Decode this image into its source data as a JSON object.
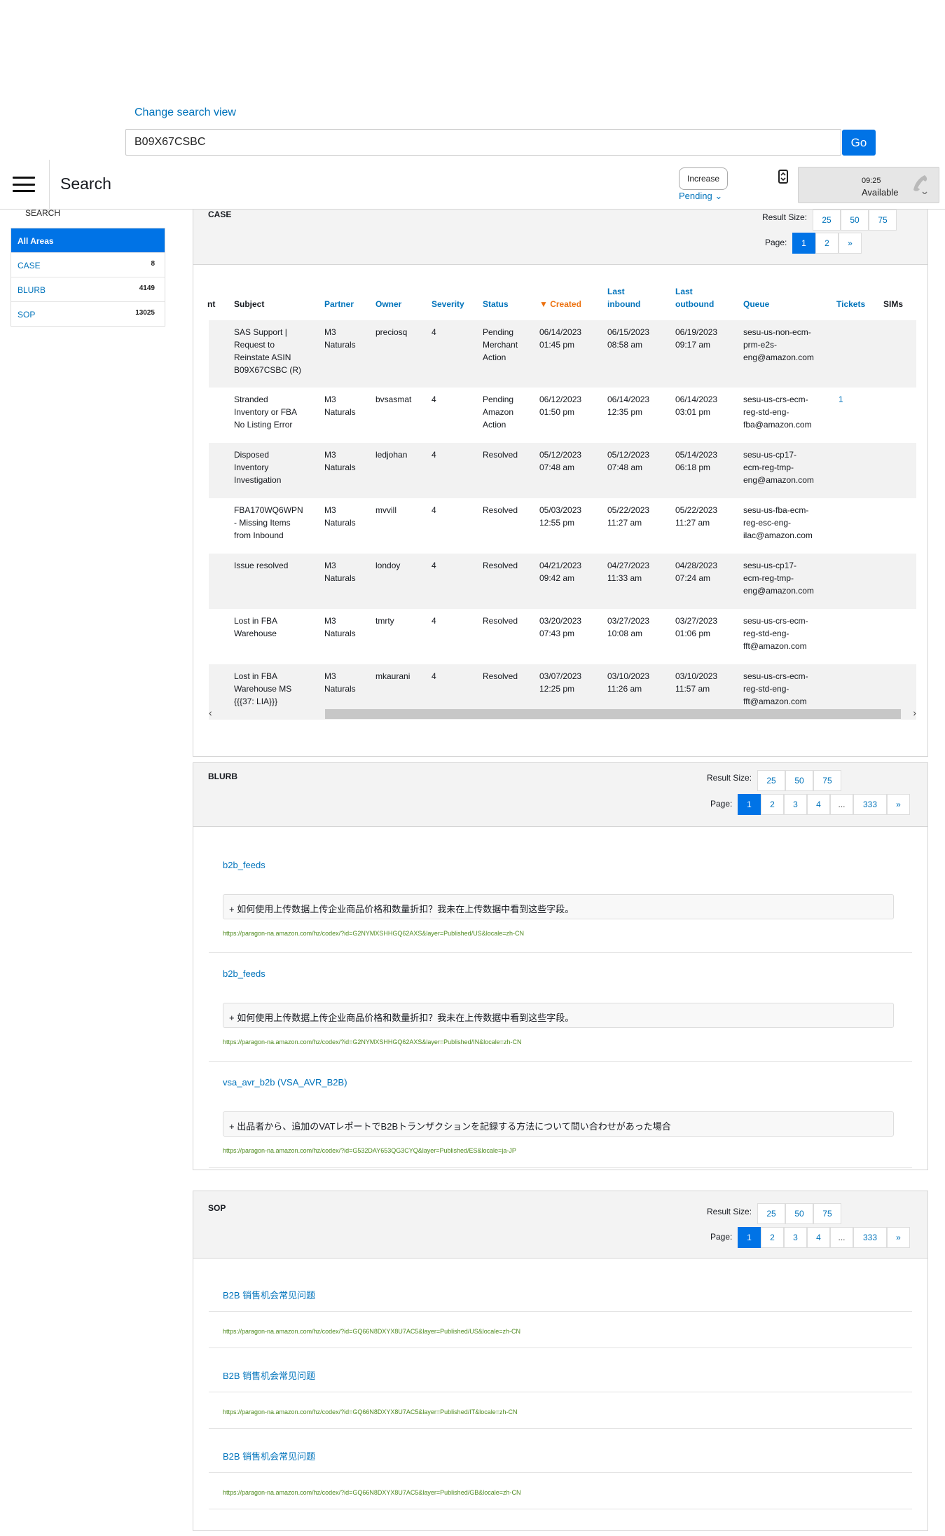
{
  "search": {
    "change_view": "Change search view",
    "query": "B09X67CSBC",
    "go_label": "Go"
  },
  "header": {
    "title": "Search",
    "increase_label": "Increase",
    "pending_label": "Pending ⌄",
    "status_time": "09:25",
    "status_text": "Available"
  },
  "sidebar": {
    "heading": "SEARCH",
    "items": [
      {
        "label": "All Areas",
        "count": ""
      },
      {
        "label": "CASE",
        "count": "8"
      },
      {
        "label": "BLURB",
        "count": "4149"
      },
      {
        "label": "SOP",
        "count": "13025"
      }
    ]
  },
  "pagination_labels": {
    "result_size": "Result Size:",
    "page": "Page:"
  },
  "case": {
    "title": "CASE",
    "result_sizes": [
      "25",
      "50",
      "75"
    ],
    "pages": [
      "1",
      "2",
      "»"
    ],
    "columns": {
      "nt": "nt",
      "subject": "Subject",
      "partner": "Partner",
      "owner": "Owner",
      "severity": "Severity",
      "status": "Status",
      "created": "▼ Created",
      "last_inbound": "Last\ninbound",
      "last_outbound": "Last\noutbound",
      "queue": "Queue",
      "tickets": "Tickets",
      "sims": "SIMs"
    },
    "rows": [
      {
        "subject": "SAS Support |\nRequest to\nReinstate ASIN\nB09X67CSBC (R)",
        "partner": "M3\nNaturals",
        "owner": "preciosq",
        "severity": "4",
        "status": "Pending\nMerchant\nAction",
        "created": "06/14/2023\n01:45 pm",
        "last_inbound": "06/15/2023\n08:58 am",
        "last_outbound": "06/19/2023\n09:17 am",
        "queue": "sesu-us-non-ecm-\nprm-e2s-\neng@amazon.com",
        "tickets": ""
      },
      {
        "subject": "Stranded\nInventory or FBA\nNo Listing Error",
        "partner": "M3\nNaturals",
        "owner": "bvsasmat",
        "severity": "4",
        "status": "Pending\nAmazon\nAction",
        "created": "06/12/2023\n01:50 pm",
        "last_inbound": "06/14/2023\n12:35 pm",
        "last_outbound": "06/14/2023\n03:01 pm",
        "queue": "sesu-us-crs-ecm-\nreg-std-eng-\nfba@amazon.com",
        "tickets": "1"
      },
      {
        "subject": "Disposed\nInventory\nInvestigation",
        "partner": "M3\nNaturals",
        "owner": "ledjohan",
        "severity": "4",
        "status": "Resolved",
        "created": "05/12/2023\n07:48 am",
        "last_inbound": "05/12/2023\n07:48 am",
        "last_outbound": "05/14/2023\n06:18 pm",
        "queue": "sesu-us-cp17-\necm-reg-tmp-\neng@amazon.com",
        "tickets": ""
      },
      {
        "subject": "FBA170WQ6WPN\n- Missing Items\nfrom Inbound",
        "partner": "M3\nNaturals",
        "owner": "mvvill",
        "severity": "4",
        "status": "Resolved",
        "created": "05/03/2023\n12:55 pm",
        "last_inbound": "05/22/2023\n11:27 am",
        "last_outbound": "05/22/2023\n11:27 am",
        "queue": "sesu-us-fba-ecm-\nreg-esc-eng-\nilac@amazon.com",
        "tickets": ""
      },
      {
        "subject": "Issue resolved",
        "partner": "M3\nNaturals",
        "owner": "londoy",
        "severity": "4",
        "status": "Resolved",
        "created": "04/21/2023\n09:42 am",
        "last_inbound": "04/27/2023\n11:33 am",
        "last_outbound": "04/28/2023\n07:24 am",
        "queue": "sesu-us-cp17-\necm-reg-tmp-\neng@amazon.com",
        "tickets": ""
      },
      {
        "subject": "Lost in FBA\nWarehouse",
        "partner": "M3\nNaturals",
        "owner": "tmrty",
        "severity": "4",
        "status": "Resolved",
        "created": "03/20/2023\n07:43 pm",
        "last_inbound": "03/27/2023\n10:08 am",
        "last_outbound": "03/27/2023\n01:06 pm",
        "queue": "sesu-us-crs-ecm-\nreg-std-eng-\nfft@amazon.com",
        "tickets": ""
      },
      {
        "subject": "Lost in FBA\nWarehouse MS\n{{{37: LIA}}}",
        "partner": "M3\nNaturals",
        "owner": "mkaurani",
        "severity": "4",
        "status": "Resolved",
        "created": "03/07/2023\n12:25 pm",
        "last_inbound": "03/10/2023\n11:26 am",
        "last_outbound": "03/10/2023\n11:57 am",
        "queue": "sesu-us-crs-ecm-\nreg-std-eng-\nfft@amazon.com",
        "tickets": ""
      }
    ],
    "scroll_left": "‹",
    "scroll_right": "›"
  },
  "blurb": {
    "title": "BLURB",
    "result_sizes": [
      "25",
      "50",
      "75"
    ],
    "pages": [
      "1",
      "2",
      "3",
      "4",
      "...",
      "333",
      "»"
    ],
    "items": [
      {
        "title": "b2b_feeds",
        "text": "+ 如何使用上传数据上传企业商品价格和数量折扣？我未在上传数据中看到这些字段。",
        "url": "https://paragon-na.amazon.com/hz/codex/?id=G2NYMXSHHGQ62AXS&layer=Published/US&locale=zh-CN"
      },
      {
        "title": "b2b_feeds",
        "text": "+ 如何使用上传数据上传企业商品价格和数量折扣？我未在上传数据中看到这些字段。",
        "url": "https://paragon-na.amazon.com/hz/codex/?id=G2NYMXSHHGQ62AXS&layer=Published/IN&locale=zh-CN"
      },
      {
        "title": "vsa_avr_b2b (VSA_AVR_B2B)",
        "text": "+ 出品者から、追加のVATレポートでB2Bトランザクションを記録する方法について問い合わせがあった場合",
        "url": "https://paragon-na.amazon.com/hz/codex/?id=G532DAY653QG3CYQ&layer=Published/ES&locale=ja-JP"
      }
    ]
  },
  "sop": {
    "title": "SOP",
    "result_sizes": [
      "25",
      "50",
      "75"
    ],
    "pages": [
      "1",
      "2",
      "3",
      "4",
      "...",
      "333",
      "»"
    ],
    "items": [
      {
        "title": "B2B 销售机会常见问题",
        "url": "https://paragon-na.amazon.com/hz/codex/?id=GQ66N8DXYX8U7AC5&layer=Published/US&locale=zh-CN"
      },
      {
        "title": "B2B 销售机会常见问题",
        "url": "https://paragon-na.amazon.com/hz/codex/?id=GQ66N8DXYX8U7AC5&layer=Published/IT&locale=zh-CN"
      },
      {
        "title": "B2B 销售机会常见问题",
        "url": "https://paragon-na.amazon.com/hz/codex/?id=GQ66N8DXYX8U7AC5&layer=Published/GB&locale=zh-CN"
      }
    ]
  }
}
